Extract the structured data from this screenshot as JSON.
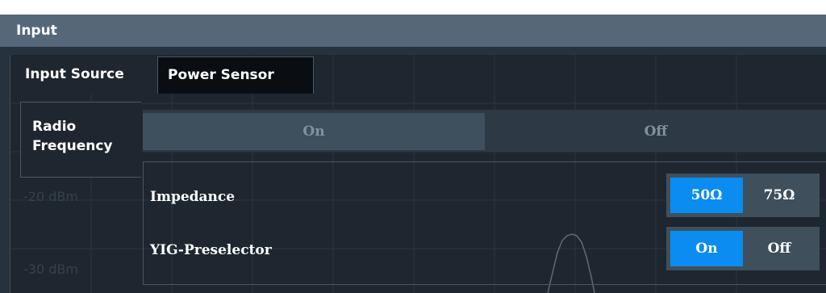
{
  "window": {
    "title": "Input"
  },
  "tabs": [
    {
      "label": "Input Source",
      "active": true
    },
    {
      "label": "Power Sensor",
      "active": false
    }
  ],
  "side_nav": {
    "radio_frequency_label": "Radio\nFrequency"
  },
  "radio_frequency": {
    "on_label": "On",
    "off_label": "Off",
    "selected": "On"
  },
  "impedance": {
    "label": "Impedance",
    "options": [
      "50Ω",
      "75Ω"
    ],
    "selected": "50Ω"
  },
  "yig_preselector": {
    "label": "YIG-Preselector",
    "options": [
      "On",
      "Off"
    ],
    "selected": "On"
  },
  "background_display": {
    "level_labels": [
      "-20 dBm",
      "-30 dBm"
    ]
  },
  "colors": {
    "accent": "#0a8cf0",
    "titlebar": "#54687a",
    "panel": "#1e2730"
  }
}
